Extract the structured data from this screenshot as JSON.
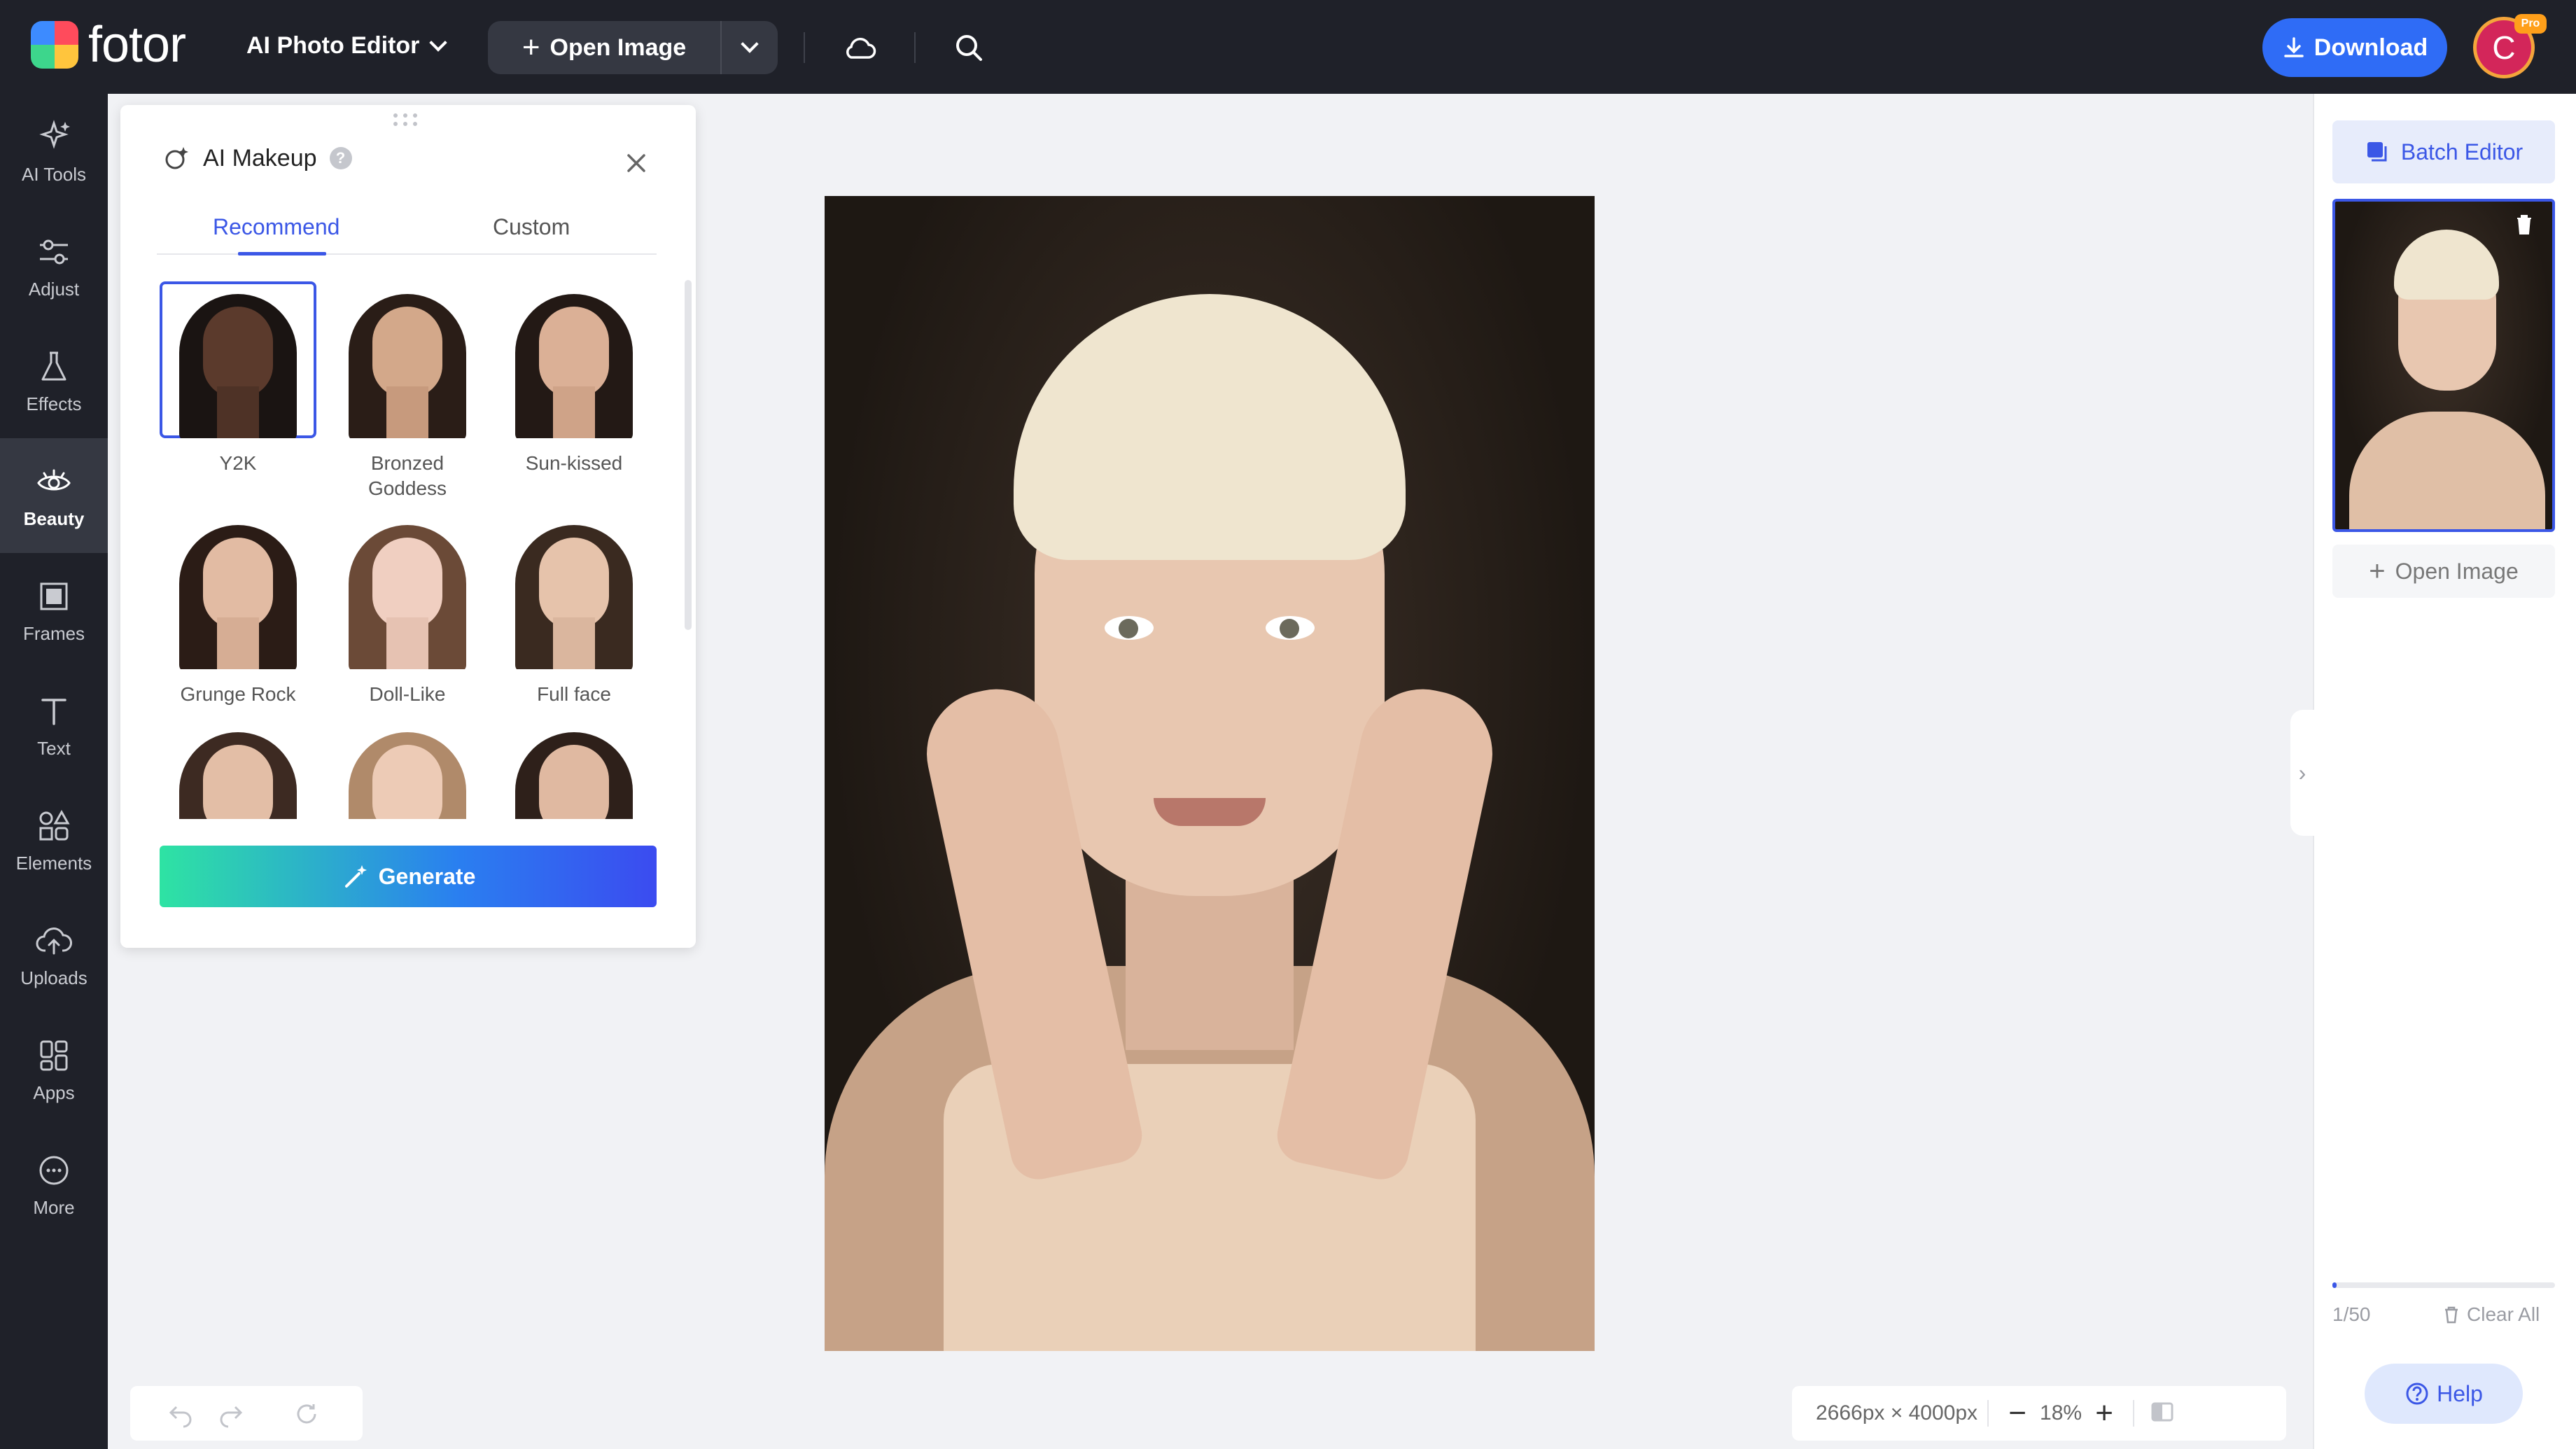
{
  "topbar": {
    "logo_text": "fotor",
    "editor_label": "AI Photo Editor",
    "open_image_label": "Open Image",
    "download_label": "Download",
    "avatar_initial": "C",
    "avatar_badge": "Pro"
  },
  "sidebar": {
    "items": [
      {
        "label": "AI Tools",
        "icon": "ai-tools-icon"
      },
      {
        "label": "Adjust",
        "icon": "adjust-icon"
      },
      {
        "label": "Effects",
        "icon": "effects-icon"
      },
      {
        "label": "Beauty",
        "icon": "beauty-icon"
      },
      {
        "label": "Frames",
        "icon": "frames-icon"
      },
      {
        "label": "Text",
        "icon": "text-icon"
      },
      {
        "label": "Elements",
        "icon": "elements-icon"
      },
      {
        "label": "Uploads",
        "icon": "uploads-icon"
      },
      {
        "label": "Apps",
        "icon": "apps-icon"
      },
      {
        "label": "More",
        "icon": "more-icon"
      }
    ],
    "active": "Beauty"
  },
  "panel": {
    "title": "AI Makeup",
    "tabs": [
      "Recommend",
      "Custom"
    ],
    "active_tab": "Recommend",
    "presets": [
      {
        "label": "Y2K",
        "selected": true
      },
      {
        "label": "Bronzed Goddess"
      },
      {
        "label": "Sun-kissed"
      },
      {
        "label": "Grunge Rock"
      },
      {
        "label": "Doll-Like"
      },
      {
        "label": "Full face"
      }
    ],
    "generate_label": "Generate"
  },
  "right_panel": {
    "batch_editor_label": "Batch Editor",
    "open_image_label": "Open Image",
    "count": "1/50",
    "progress": 0.02,
    "clear_all_label": "Clear All",
    "help_label": "Help"
  },
  "bottom": {
    "dimensions": "2666px × 4000px",
    "zoom": "18%"
  },
  "colors": {
    "accent": "#3b57e6",
    "topbar": "#1f2129",
    "download": "#2f6cf6"
  }
}
